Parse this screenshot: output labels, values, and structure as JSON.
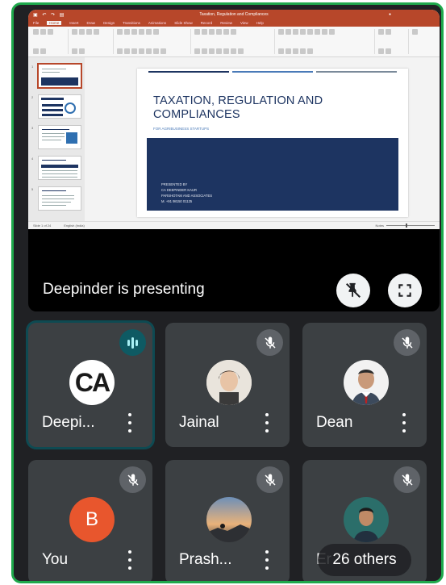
{
  "presentation": {
    "app_window_title": "Taxation, Regulation and Compliances",
    "ribbon_tabs": [
      "File",
      "Home",
      "Insert",
      "Draw",
      "Design",
      "Transitions",
      "Animations",
      "Slide Show",
      "Record",
      "Review",
      "View",
      "Help"
    ],
    "active_tab": "Home",
    "slide": {
      "title": "TAXATION, REGULATION AND COMPLIANCES",
      "subtitle": "FOR AGRIBUSINESS STARTUPS",
      "presenter_lines": [
        "PRESENTED BY",
        "CA DEEPINDER KAUR",
        "PARSHOTAM AND ASSOCIATES",
        "M. +91 98150 01125"
      ]
    },
    "status_left": "Slide 1 of 24",
    "status_lang": "English (India)",
    "status_notes": "Notes",
    "presenting_label": "Deepinder is presenting",
    "accent": "#b7472a",
    "slide_navy": "#1d3461"
  },
  "controls": {
    "unpin_icon": "unpin-icon",
    "fullscreen_icon": "fullscreen-icon"
  },
  "participants": [
    {
      "name": "Deepi...",
      "avatar": "CA",
      "state": "speaking"
    },
    {
      "name": "Jainal",
      "avatar": "photo",
      "state": "muted"
    },
    {
      "name": "Dean",
      "avatar": "photo",
      "state": "muted"
    },
    {
      "name": "You",
      "avatar": "B",
      "state": "muted"
    },
    {
      "name": "Prash...",
      "avatar": "photo",
      "state": "muted"
    },
    {
      "name": "Er",
      "avatar": "photo",
      "state": "muted"
    }
  ],
  "others_label": "26 others",
  "colors": {
    "frame_border": "#1fa94c",
    "tile_bg": "#3c4043",
    "speaking_ring": "#0e4a52",
    "you_avatar": "#e8562d"
  }
}
